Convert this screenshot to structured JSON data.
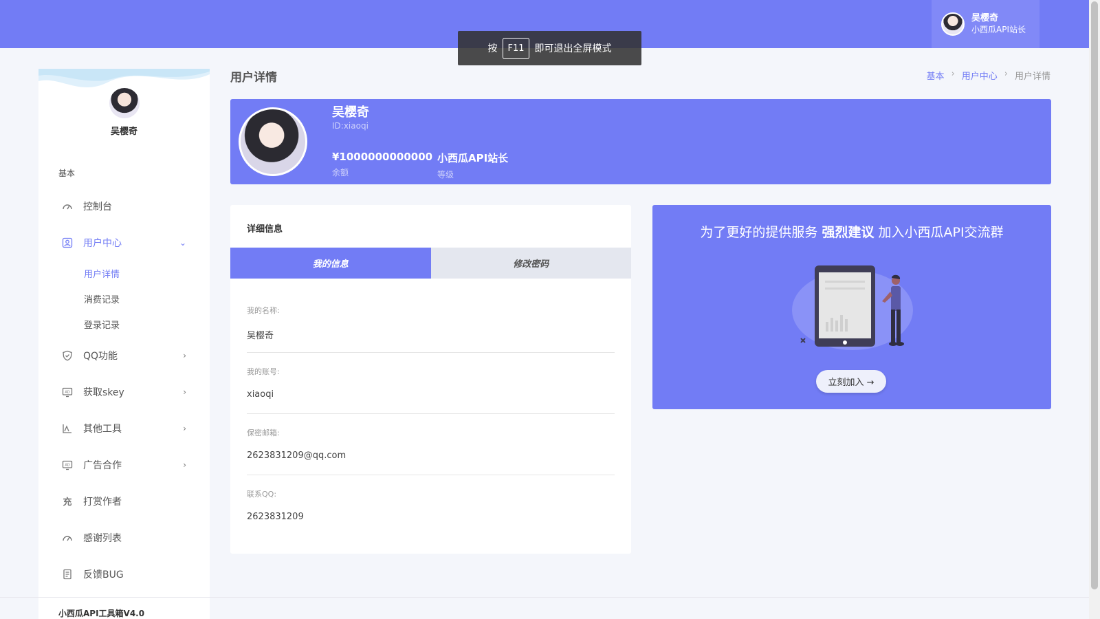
{
  "header": {
    "user_name": "吴樱奇",
    "user_role": "小西瓜API站长"
  },
  "toast": {
    "prefix": "按",
    "key": "F11",
    "suffix": "即可退出全屏模式"
  },
  "sidebar": {
    "profile_name": "吴樱奇",
    "section": "基本",
    "items": [
      {
        "label": "控制台",
        "icon": "dashboard-icon"
      },
      {
        "label": "用户中心",
        "icon": "user-icon",
        "expanded": true
      },
      {
        "label": "QQ功能",
        "icon": "shield-icon"
      },
      {
        "label": "获取skey",
        "icon": "ad-icon"
      },
      {
        "label": "其他工具",
        "icon": "chart-icon"
      },
      {
        "label": "广告合作",
        "icon": "ad-icon"
      },
      {
        "label": "打赏作者",
        "icon": "charge-icon"
      },
      {
        "label": "感谢列表",
        "icon": "dashboard-icon"
      },
      {
        "label": "反馈BUG",
        "icon": "report-icon"
      }
    ],
    "sub_items": [
      "用户详情",
      "消费记录",
      "登录记录"
    ],
    "footer": "小西瓜API工具箱V4.0",
    "icon_glyphs": {
      "charge": "充"
    }
  },
  "page": {
    "title": "用户详情",
    "breadcrumb": [
      "基本",
      "用户中心",
      "用户详情"
    ]
  },
  "hero": {
    "name": "吴樱奇",
    "id": "ID:xiaoqi",
    "balance_value": "¥1000000000000",
    "balance_label": "余额",
    "level_value": "小西瓜API站长",
    "level_label": "等级"
  },
  "detail": {
    "title": "详细信息",
    "tabs": [
      "我的信息",
      "修改密码"
    ],
    "fields": [
      {
        "label": "我的名称:",
        "value": "吴樱奇"
      },
      {
        "label": "我的账号:",
        "value": "xiaoqi"
      },
      {
        "label": "保密邮箱:",
        "value": "2623831209@qq.com"
      },
      {
        "label": "联系QQ:",
        "value": "2623831209"
      }
    ]
  },
  "promo": {
    "text_before": "为了更好的提供服务 ",
    "text_bold": "强烈建议",
    "text_after": " 加入小西瓜API交流群",
    "button": "立刻加入 →"
  },
  "colors": {
    "accent": "#727cf5",
    "background": "#f4f6fb"
  }
}
